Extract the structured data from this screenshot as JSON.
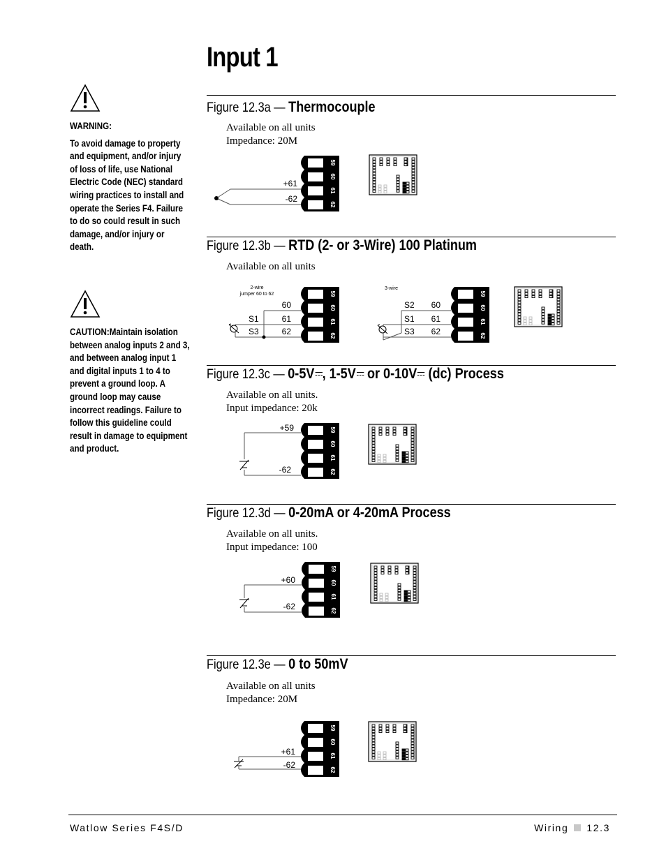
{
  "page": {
    "title": "Input 1",
    "footer_left": "Watlow Series F4S/D",
    "footer_section": "Wiring",
    "footer_page": "12.3"
  },
  "sidebar": {
    "warning": {
      "icon": "warning-triangle-icon",
      "heading": "WARNING:",
      "body": "To avoid damage to property and equipment, and/or injury of loss of life, use National Electric Code (NEC) standard wiring practices to install and operate the Series F4. Failure to do so could result in such damage, and/or injury or death."
    },
    "caution": {
      "icon": "warning-triangle-icon",
      "body": "CAUTION:Maintain isolation between analog inputs 2 and 3, and between analog input 1 and digital inputs 1 to 4 to prevent a ground loop. A ground loop may cause incorrect readings. Failure to follow this guideline could result in damage to equipment and product."
    }
  },
  "terminal_labels": [
    "59",
    "60",
    "61",
    "62"
  ],
  "figures": [
    {
      "number": "Figure 12.3a —",
      "name": "Thermocouple",
      "lines": [
        "Available on all units",
        "Impedance: 20M"
      ],
      "wires": {
        "plus": "+61",
        "minus": "-62"
      }
    },
    {
      "number": "Figure 12.3b —",
      "name": "RTD (2- or 3-Wire) 100    Platinum",
      "lines": [
        "Available on all units"
      ],
      "two_wire": {
        "caption1": "2-wire",
        "caption2": "jumper 60 to 62",
        "t60": "60",
        "t61": "61",
        "t62": "62",
        "s1": "S1",
        "s3": "S3"
      },
      "three_wire": {
        "caption": "3-wire",
        "t60": "60",
        "t61": "61",
        "t62": "62",
        "s1": "S1",
        "s2": "S2",
        "s3": "S3"
      }
    },
    {
      "number": "Figure 12.3c —",
      "name_parts": [
        "0-5V",
        ", 1-5V",
        " or 0-10V",
        " (dc) Process"
      ],
      "lines": [
        "Available on all units.",
        "Input impedance: 20k"
      ],
      "wires": {
        "plus": "+59",
        "minus": "-62"
      }
    },
    {
      "number": "Figure 12.3d —",
      "name": "0-20mA or 4-20mA Process",
      "lines": [
        "Available on all units.",
        "Input impedance: 100"
      ],
      "wires": {
        "plus": "+60",
        "minus": "-62"
      }
    },
    {
      "number": "Figure 12.3e —",
      "name": "0 to 50mV",
      "lines": [
        "Available on all units",
        "Impedance: 20M"
      ],
      "wires": {
        "plus": "+61",
        "minus": "-62"
      }
    }
  ]
}
